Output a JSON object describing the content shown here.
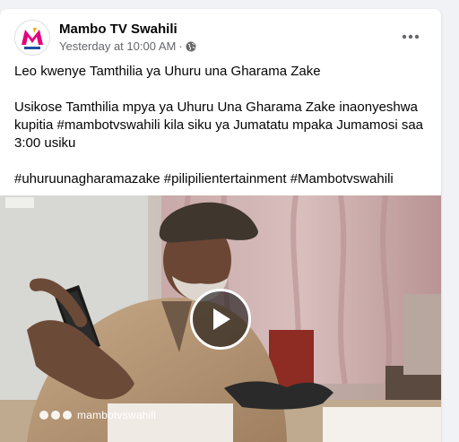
{
  "post": {
    "page_name": "Mambo TV Swahili",
    "timestamp": "Yesterday at 10:00 AM",
    "separator": "·",
    "audience_icon": "globe-icon",
    "more_icon": "more-options-icon",
    "text": {
      "line1": "Leo kwenye Tamthilia ya Uhuru una Gharama Zake",
      "line2": "Usikose Tamthilia mpya ya Uhuru Una Gharama Zake inaonyeshwa kupitia #mambotvswahili kila siku ya Jumatatu mpaka Jumamosi saa 3:00 usiku",
      "hashtags": "#uhuruunagharamazake #pilipilientertainment #Mambotvswahili"
    }
  },
  "video": {
    "watermark": "mambotvswahili",
    "watermark_icons": [
      "instagram-icon",
      "twitter-icon",
      "facebook-icon"
    ],
    "play_icon": "play-icon"
  },
  "colors": {
    "brand_m": "#e4007c",
    "brand_v": "#f5a800",
    "secondary_text": "#65676b",
    "background": "#f0f2f5"
  }
}
